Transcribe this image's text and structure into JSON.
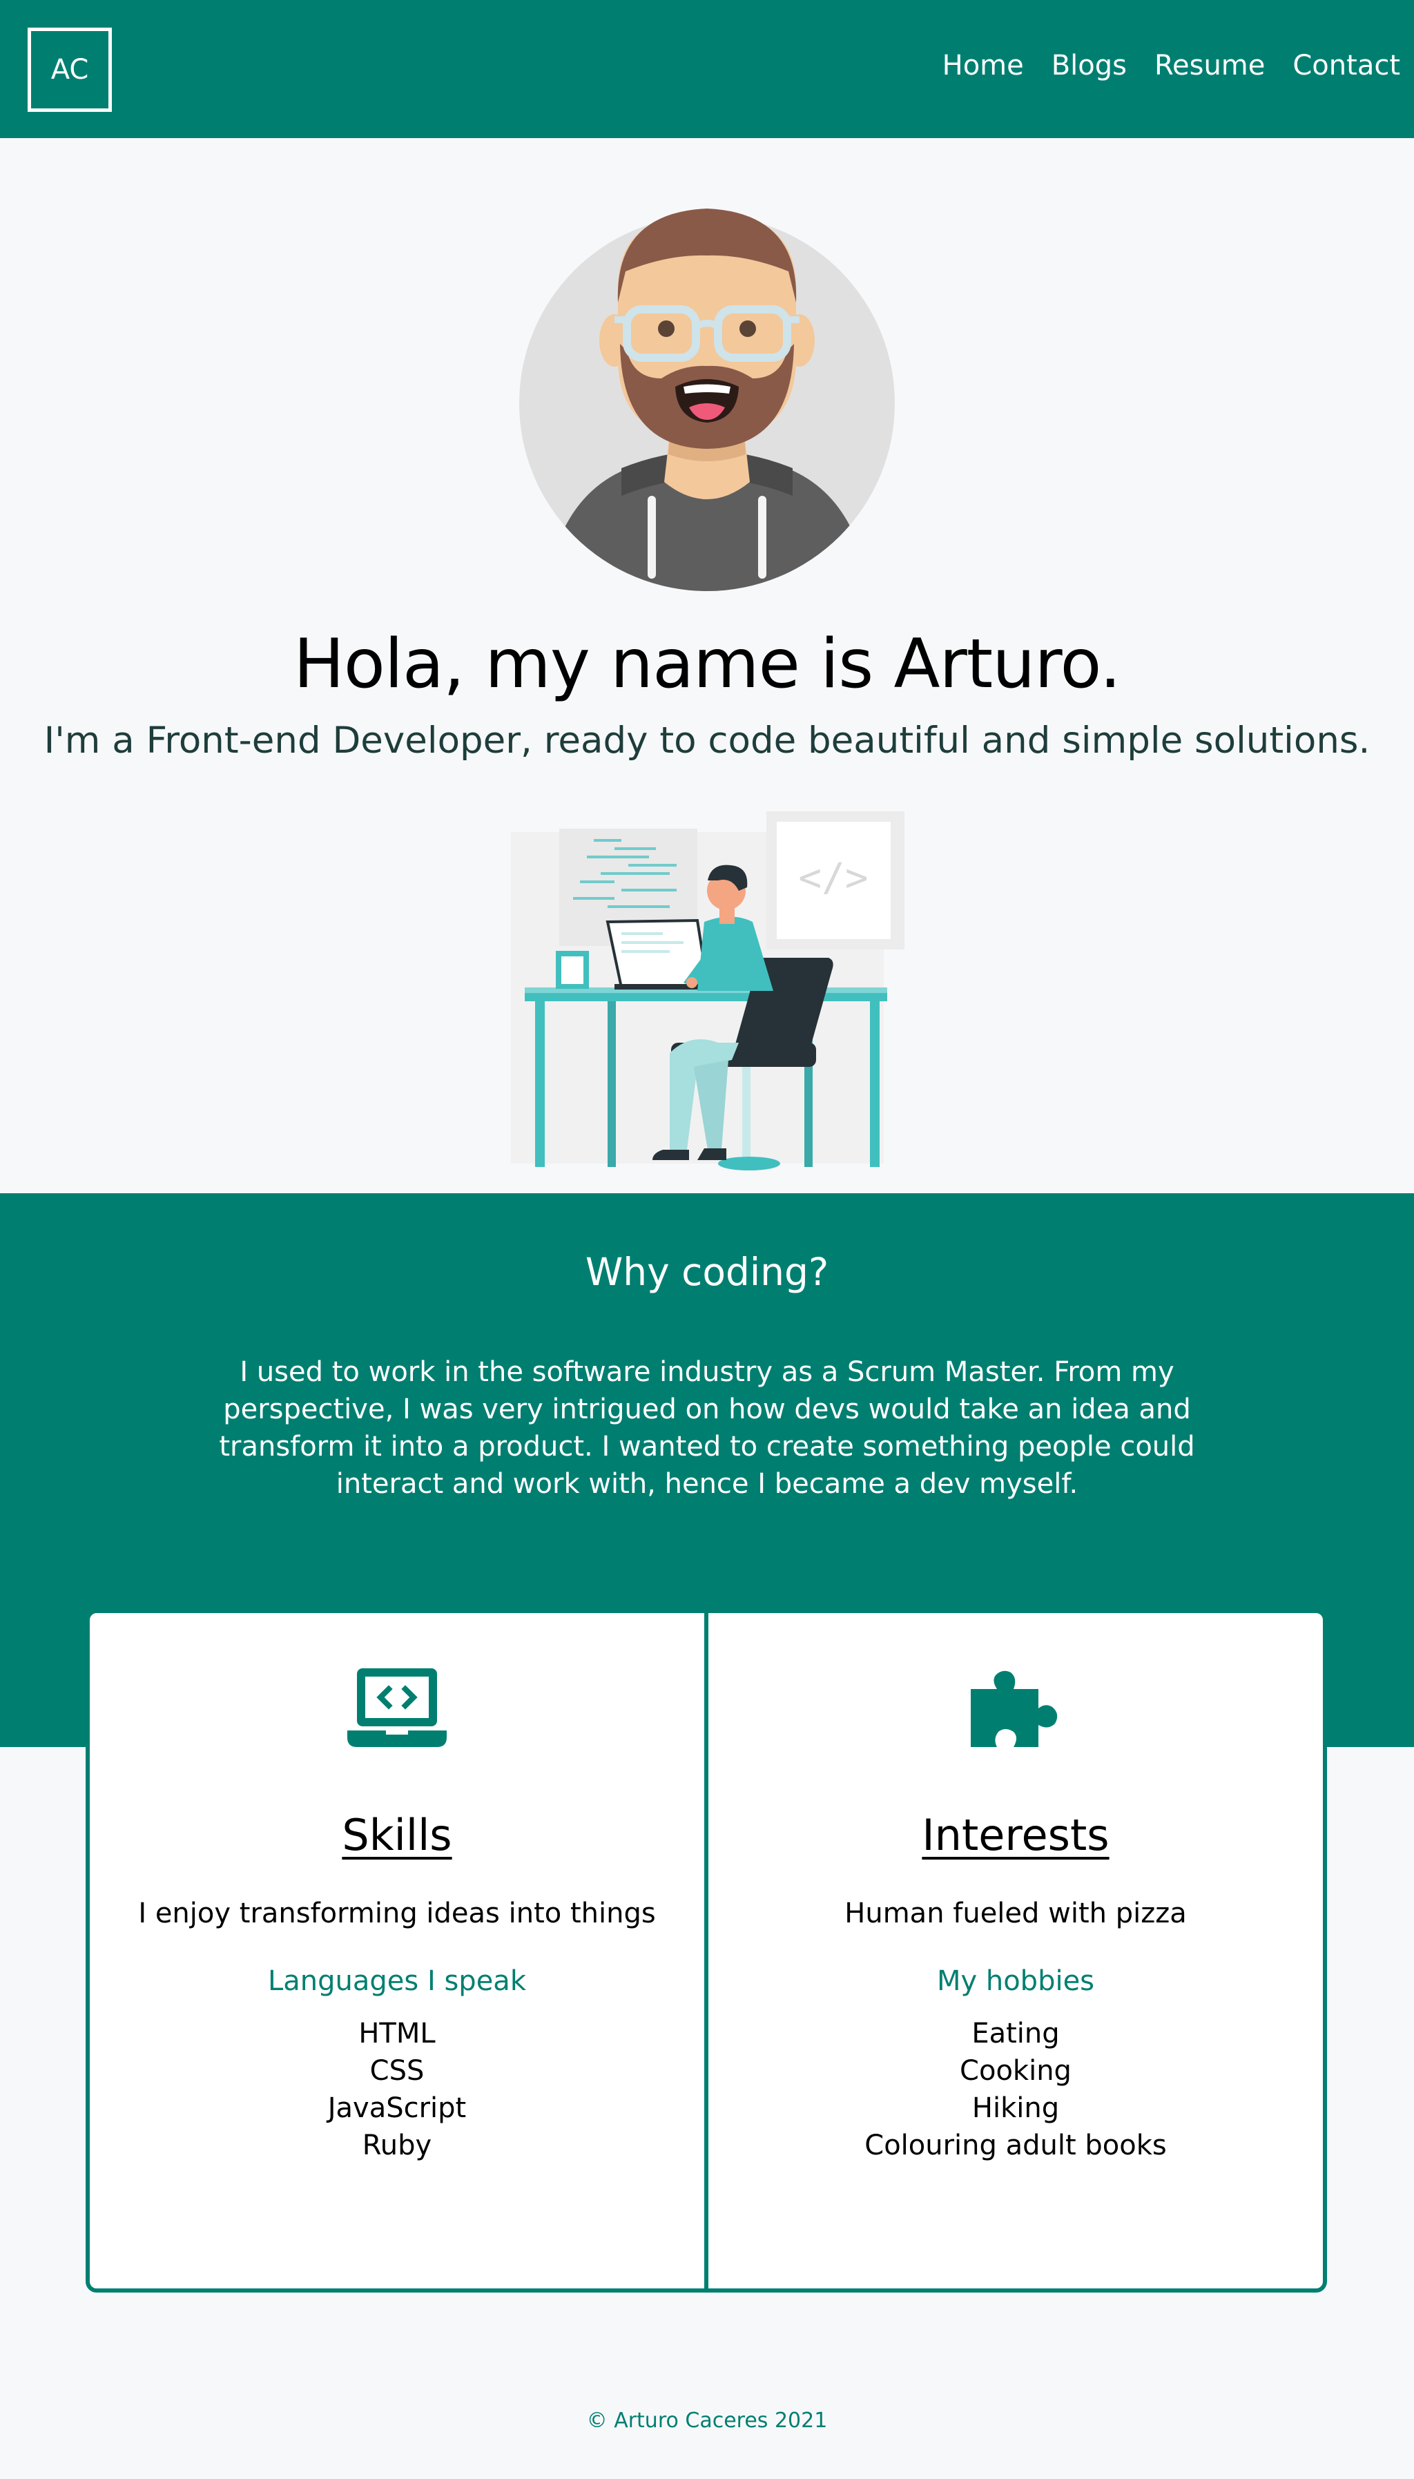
{
  "header": {
    "logo": "AC",
    "nav": [
      "Home",
      "Blogs",
      "Resume",
      "Contact"
    ]
  },
  "hero": {
    "title": "Hola, my name is Arturo.",
    "subtitle": "I'm a Front-end Developer, ready to code beautiful and simple solutions.",
    "illustration_code": "</>"
  },
  "why": {
    "title": "Why coding?",
    "text": "I used to work in the software industry as a Scrum Master. From my perspective, I was very intrigued on how devs would take an idea and transform it into a product. I wanted to create something people could interact and work with, hence I became a dev myself."
  },
  "cards": [
    {
      "icon": "laptop-code-icon",
      "title": "Skills",
      "tagline": "I enjoy transforming ideas into things",
      "subtitle": "Languages I speak",
      "items": [
        "HTML",
        "CSS",
        "JavaScript",
        "Ruby"
      ]
    },
    {
      "icon": "puzzle-piece-icon",
      "title": "Interests",
      "tagline": "Human fueled with pizza",
      "subtitle": "My hobbies",
      "items": [
        "Eating",
        "Cooking",
        "Hiking",
        "Colouring adult books"
      ]
    }
  ],
  "footer": {
    "text": "© Arturo Caceres 2021"
  },
  "colors": {
    "primary": "#007f71",
    "background": "#f7f8fa",
    "illustration_teal": "#41bfbf"
  }
}
